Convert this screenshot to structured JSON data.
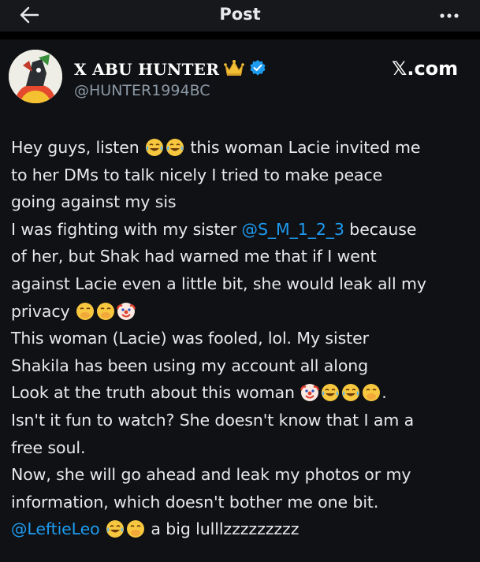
{
  "header": {
    "title": "Post",
    "back_icon": "back-arrow-icon",
    "more_icon": "more-dots-icon"
  },
  "author": {
    "name": "X ABU HUNTER",
    "crown_icon": "crown-icon",
    "verified_icon": "verified-badge-icon",
    "handle": "@HUNTER1994BC"
  },
  "watermark": "𝕏.com",
  "tweet": {
    "l1a": "Hey guys, listen ",
    "l1b": " this woman Lacie invited me",
    "l2": "to her DMs to talk nicely I tried to make peace",
    "l3": "going against my sis",
    "l4a": "I was fighting with my sister ",
    "l4m": "@S_M_1_2_3",
    "l4b": " because",
    "l5": "of her, but Shak had warned me that if I went",
    "l6": "against Lacie even a little bit, she would leak all my",
    "l7": "privacy ",
    "l8": "This woman (Lacie) was fooled, lol. My sister",
    "l9": "Shakila has been using my account all along",
    "l10a": "Look at the truth about this woman ",
    "l10b": ".",
    "l11": "Isn't it fun to watch? She doesn't know that I am a",
    "l12": "free soul.",
    "l13": "Now, she will go ahead and leak my photos or my",
    "l14": "information, which doesn't bother me one bit.",
    "l15m": "@LeftieLeo",
    "l15b": " a big lulllzzzzzzzzz"
  },
  "colors": {
    "accent": "#1d9bf0",
    "background": "#101114",
    "text": "#e7e9ea",
    "secondary": "#8b98a5"
  }
}
